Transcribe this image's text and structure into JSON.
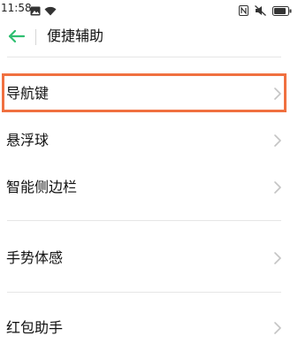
{
  "status_bar": {
    "time": "11:58",
    "icons": [
      "notification-image-icon",
      "wifi-icon",
      "nfc-icon",
      "mute-icon",
      "battery-icon"
    ]
  },
  "header": {
    "back_icon": "back-arrow-icon",
    "title": "便捷辅助"
  },
  "groups": [
    {
      "items": [
        {
          "label": "导航键",
          "highlighted": true
        },
        {
          "label": "悬浮球"
        },
        {
          "label": "智能侧边栏"
        }
      ]
    },
    {
      "items": [
        {
          "label": "手势体感"
        }
      ]
    },
    {
      "items": [
        {
          "label": "红包助手"
        }
      ]
    }
  ],
  "colors": {
    "accent": "#2fbf71",
    "highlight_border": "#f07040",
    "divider": "#e6e6e6",
    "chevron": "#c4c4c4"
  }
}
